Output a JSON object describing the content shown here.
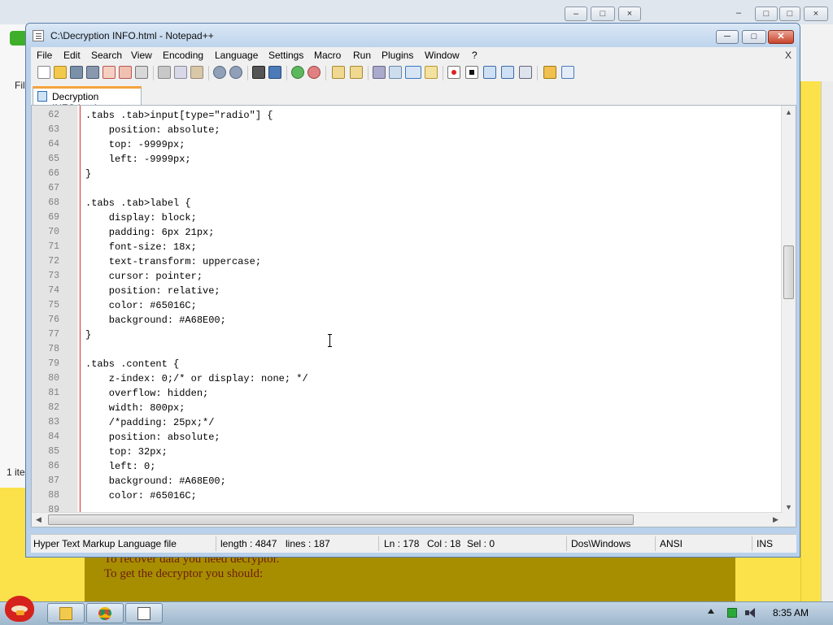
{
  "background": {
    "browser_menu_fragment": "Fil",
    "browser_status_fragment": "1 ite",
    "page_lines": [
      "To recover data you need decryptor.",
      "To get the decryptor you should:"
    ]
  },
  "window": {
    "title": "C:\\Decryption INFO.html - Notepad++",
    "minimize_label": "─",
    "maximize_label": "□",
    "close_label": "✕"
  },
  "menubar": {
    "items": [
      "File",
      "Edit",
      "Search",
      "View",
      "Encoding",
      "Language",
      "Settings",
      "Macro",
      "Run",
      "Plugins",
      "Window",
      "?"
    ],
    "doc_close_label": "X"
  },
  "tab": {
    "label": "Decryption INFO.html"
  },
  "editor": {
    "lines": [
      {
        "num": "62",
        "text": ".tabs .tab>input[type=\"radio\"] {"
      },
      {
        "num": "63",
        "text": "    position: absolute;"
      },
      {
        "num": "64",
        "text": "    top: -9999px;"
      },
      {
        "num": "65",
        "text": "    left: -9999px;"
      },
      {
        "num": "66",
        "text": "}"
      },
      {
        "num": "67",
        "text": ""
      },
      {
        "num": "68",
        "text": ".tabs .tab>label {"
      },
      {
        "num": "69",
        "text": "    display: block;"
      },
      {
        "num": "70",
        "text": "    padding: 6px 21px;"
      },
      {
        "num": "71",
        "text": "    font-size: 18x;"
      },
      {
        "num": "72",
        "text": "    text-transform: uppercase;"
      },
      {
        "num": "73",
        "text": "    cursor: pointer;"
      },
      {
        "num": "74",
        "text": "    position: relative;"
      },
      {
        "num": "75",
        "text": "    color: #65016C;"
      },
      {
        "num": "76",
        "text": "    background: #A68E00;"
      },
      {
        "num": "77",
        "text": "}"
      },
      {
        "num": "78",
        "text": ""
      },
      {
        "num": "79",
        "text": ".tabs .content {"
      },
      {
        "num": "80",
        "text": "    z-index: 0;/* or display: none; */"
      },
      {
        "num": "81",
        "text": "    overflow: hidden;"
      },
      {
        "num": "82",
        "text": "    width: 800px;"
      },
      {
        "num": "83",
        "text": "    /*padding: 25px;*/"
      },
      {
        "num": "84",
        "text": "    position: absolute;"
      },
      {
        "num": "85",
        "text": "    top: 32px;"
      },
      {
        "num": "86",
        "text": "    left: 0;"
      },
      {
        "num": "87",
        "text": "    background: #A68E00;"
      },
      {
        "num": "88",
        "text": "    color: #65016C;"
      },
      {
        "num": "89",
        "text": ""
      }
    ]
  },
  "statusbar": {
    "file_type": "Hyper Text Markup Language file",
    "length": "length : 4847",
    "lines": "lines : 187",
    "ln": "Ln : 178",
    "col": "Col : 18",
    "sel": "Sel : 0",
    "eol": "Dos\\Windows",
    "encoding": "ANSI",
    "mode": "INS"
  },
  "taskbar": {
    "clock": "8:35 AM"
  },
  "colors": {
    "desktop_yellow": "#fbe24a",
    "page_gold": "#a68e00",
    "fold_margin_red": "#dd3333",
    "tab_accent": "#f4a43c"
  },
  "icons": [
    "notepad-icon",
    "new-file-icon",
    "open-file-icon",
    "save-icon",
    "save-all-icon",
    "close-file-icon",
    "close-all-icon",
    "print-icon",
    "cut-icon",
    "copy-icon",
    "paste-icon",
    "undo-icon",
    "redo-icon",
    "find-icon",
    "replace-icon",
    "zoom-in-icon",
    "zoom-out-icon",
    "sync-v-icon",
    "sync-h-icon",
    "word-wrap-icon",
    "show-all-chars-icon",
    "indent-guide-icon",
    "doc-map-icon",
    "record-macro-icon",
    "stop-macro-icon",
    "play-macro-icon",
    "run-macro-multiple-icon",
    "save-macro-icon",
    "folder-icon",
    "spellcheck-icon",
    "angry-bird-start-icon",
    "explorer-icon",
    "chrome-icon",
    "notepad-taskbar-icon"
  ]
}
